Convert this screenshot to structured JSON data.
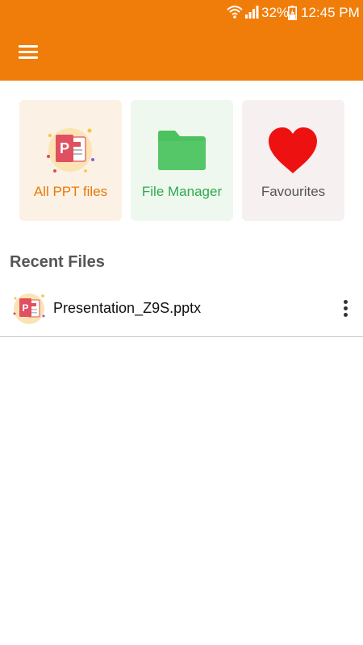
{
  "status_bar": {
    "battery_percent": "32%",
    "time": "12:45 PM"
  },
  "app_bar": {
    "menu_icon": "hamburger-menu-icon",
    "color": "#f07d0a"
  },
  "quick_cards": [
    {
      "label": "All PPT files",
      "icon": "ppt-file-icon",
      "color": "#e8790c"
    },
    {
      "label": "File Manager",
      "icon": "folder-icon",
      "color": "#2eaa4a"
    },
    {
      "label": "Favourites",
      "icon": "heart-icon",
      "color": "#555555"
    }
  ],
  "recent": {
    "title": "Recent Files",
    "files": [
      {
        "name": "Presentation_Z9S.pptx",
        "icon": "ppt-file-icon",
        "menu_icon": "more-vertical-icon"
      }
    ]
  }
}
